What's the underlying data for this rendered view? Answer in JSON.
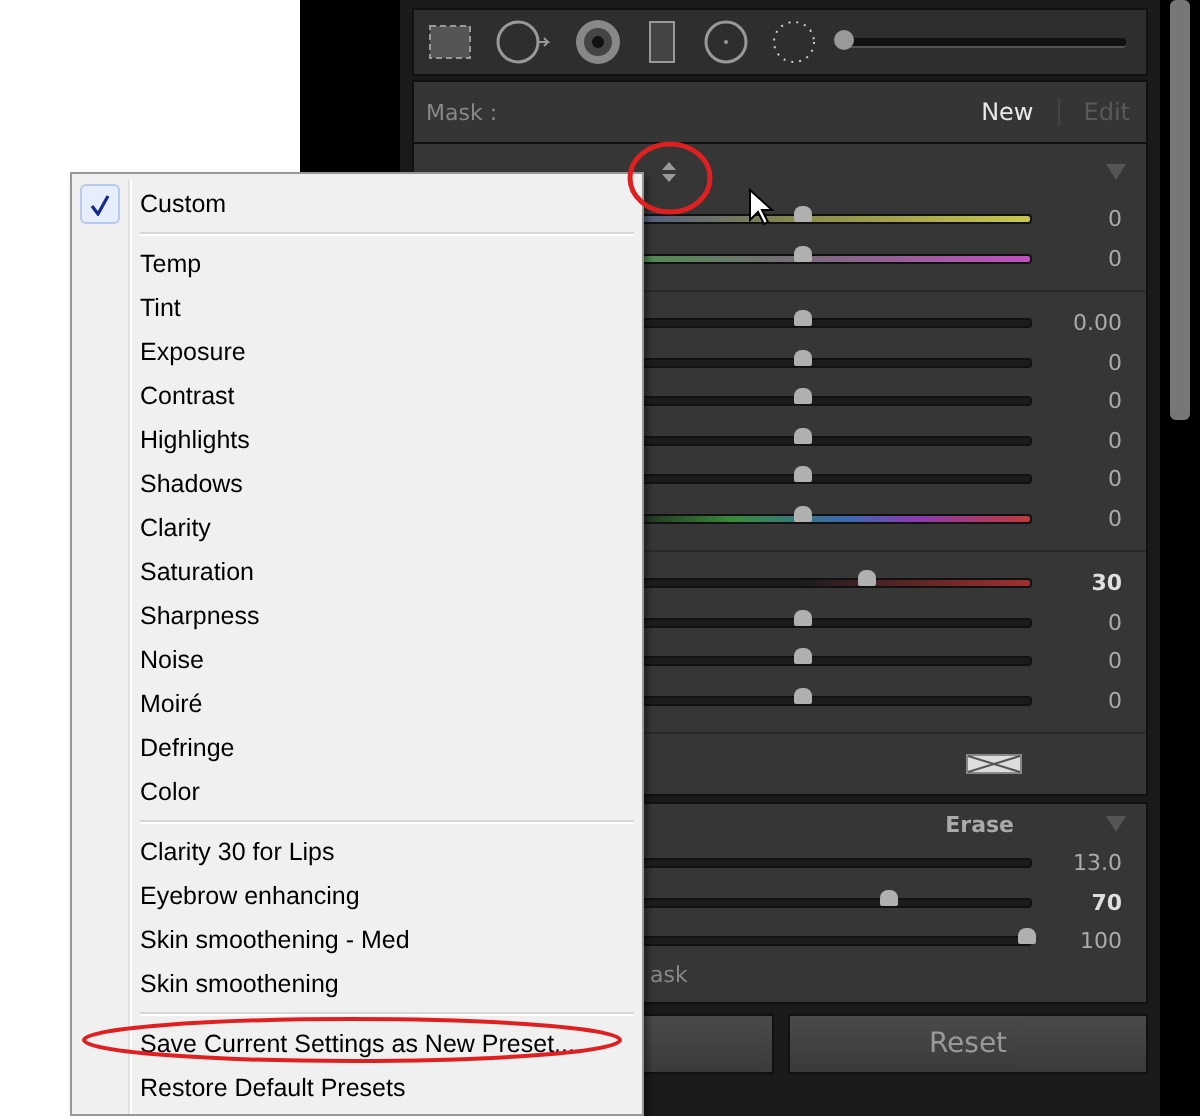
{
  "toolbar": {
    "brush_size": {
      "level": 0
    }
  },
  "mask": {
    "label": "Mask :",
    "actions": [
      {
        "label": "New",
        "disabled": false
      },
      {
        "label": "Edit",
        "disabled": true
      }
    ]
  },
  "effect_groups": [
    [
      {
        "kind": "temp",
        "level": 0.5,
        "reading": "0"
      },
      {
        "kind": "tint",
        "level": 0.5,
        "reading": "0"
      }
    ],
    [
      {
        "kind": "plain",
        "level": 0.5,
        "reading": "0.00"
      },
      {
        "kind": "plain",
        "level": 0.5,
        "reading": "0"
      },
      {
        "kind": "plain",
        "level": 0.5,
        "reading": "0"
      },
      {
        "kind": "plain",
        "level": 0.5,
        "reading": "0"
      },
      {
        "kind": "plain",
        "level": 0.5,
        "reading": "0"
      },
      {
        "kind": "hue",
        "level": 0.5,
        "reading": "0"
      }
    ],
    [
      {
        "kind": "red",
        "level": 0.64,
        "reading": "30"
      },
      {
        "kind": "plain",
        "level": 0.5,
        "reading": "0"
      },
      {
        "kind": "plain",
        "level": 0.5,
        "reading": "0"
      },
      {
        "kind": "plain",
        "level": 0.5,
        "reading": "0"
      }
    ]
  ],
  "brush": {
    "mode": "Erase",
    "rows": [
      {
        "reading": "13.0"
      },
      {
        "level": 0.69,
        "reading": "70"
      },
      {
        "level": 0.99,
        "reading": "100"
      }
    ],
    "note": "ask"
  },
  "buttons": [
    {
      "label": "Reset"
    }
  ],
  "menu": {
    "groups": [
      [
        {
          "label": "Custom",
          "selected": true
        }
      ],
      [
        {
          "label": "Temp",
          "selected": false
        },
        {
          "label": "Tint",
          "selected": false
        },
        {
          "label": "Exposure",
          "selected": false
        },
        {
          "label": "Contrast",
          "selected": false
        },
        {
          "label": "Highlights",
          "selected": false
        },
        {
          "label": "Shadows",
          "selected": false
        },
        {
          "label": "Clarity",
          "selected": false
        },
        {
          "label": "Saturation",
          "selected": false
        },
        {
          "label": "Sharpness",
          "selected": false
        },
        {
          "label": "Noise",
          "selected": false
        },
        {
          "label": "Moiré",
          "selected": false
        },
        {
          "label": "Defringe",
          "selected": false
        },
        {
          "label": "Color",
          "selected": false
        }
      ],
      [
        {
          "label": "Clarity 30 for Lips",
          "selected": false
        },
        {
          "label": "Eyebrow enhancing",
          "selected": false
        },
        {
          "label": "Skin smoothening - Med",
          "selected": false
        },
        {
          "label": "Skin smoothening",
          "selected": false
        }
      ],
      [
        {
          "label": "Save Current Settings as New Preset...",
          "selected": false
        },
        {
          "label": "Restore Default Presets",
          "selected": false
        }
      ]
    ]
  }
}
